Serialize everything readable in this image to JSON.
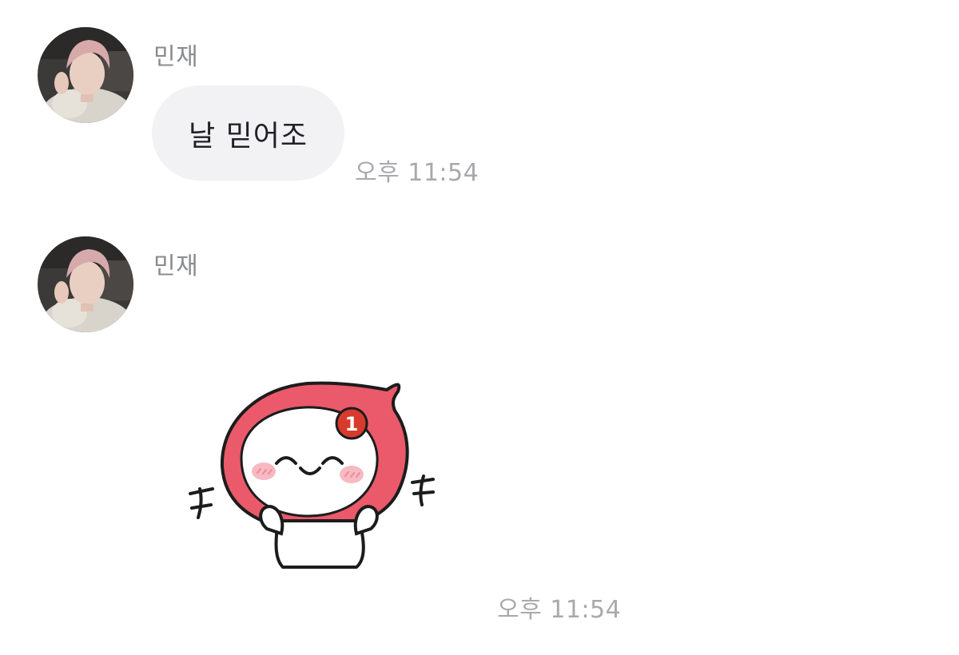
{
  "messages": [
    {
      "sender": "민재",
      "type": "text",
      "text": "날 믿어조",
      "time": "오후 11:54"
    },
    {
      "sender": "민재",
      "type": "sticker",
      "sticker": {
        "badge": "1",
        "body_color": "#ea5a6a",
        "badge_color": "#d93a2e"
      },
      "time": "오후 11:54"
    }
  ],
  "colors": {
    "bubble_bg": "#f2f2f5",
    "name_text": "#8a8b90",
    "time_text": "#a8a9ae",
    "message_text": "#222226"
  }
}
